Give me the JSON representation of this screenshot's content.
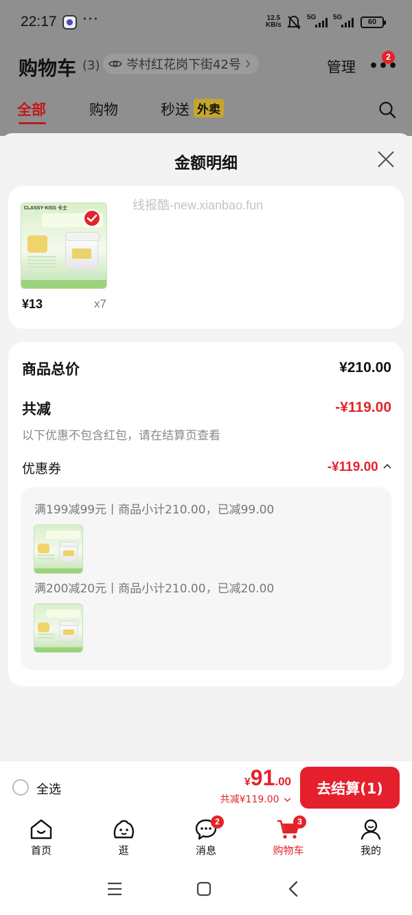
{
  "status_bar": {
    "time": "22:17",
    "more": "···",
    "net_speed_value": "12.5",
    "net_speed_unit": "KB/s",
    "sim1": "5G",
    "sim2": "5G",
    "battery": "60"
  },
  "cart": {
    "title": "购物车",
    "count": "(3)",
    "address": "岑村红花岗下街42号",
    "manage": "管理",
    "more_badge": "2",
    "tabs": [
      {
        "label": "全部",
        "active": true
      },
      {
        "label": "购物",
        "active": false
      },
      {
        "label": "秒送",
        "active": false
      }
    ],
    "takeaway_tag": "外卖"
  },
  "sheet": {
    "title": "金额明细",
    "watermark": "线报酷-new.xianbao.fun",
    "product": {
      "brand": "CLASSY·KISS 卡士",
      "price": "¥13",
      "quantity": "x7"
    },
    "goods_total_label": "商品总价",
    "goods_total_value": "¥210.00",
    "reduction_label": "共减",
    "reduction_value": "-¥119.00",
    "reduction_note": "以下优惠不包含红包，请在结算页查看",
    "coupon_label": "优惠券",
    "coupon_value": "-¥119.00",
    "coupon_rules": [
      {
        "text": "满199减99元丨商品小计210.00，已减99.00"
      },
      {
        "text": "满200减20元丨商品小计210.00，已减20.00"
      }
    ]
  },
  "checkout": {
    "select_all": "全选",
    "total_yen": "¥",
    "total_int": "91",
    "total_dec": ".00",
    "saved": "共减¥119.00",
    "pay_button": "去结算(1)"
  },
  "tabbar": {
    "items": [
      {
        "label": "首页",
        "icon": "home-icon",
        "badge": ""
      },
      {
        "label": "逛",
        "icon": "browse-icon",
        "badge": ""
      },
      {
        "label": "消息",
        "icon": "message-icon",
        "badge": "2"
      },
      {
        "label": "购物车",
        "icon": "cart-icon",
        "badge": "3",
        "active": true
      },
      {
        "label": "我的",
        "icon": "profile-icon",
        "badge": ""
      }
    ]
  },
  "colors": {
    "accent_red": "#e3232a",
    "dim_overlay": "#8f8f8f"
  }
}
